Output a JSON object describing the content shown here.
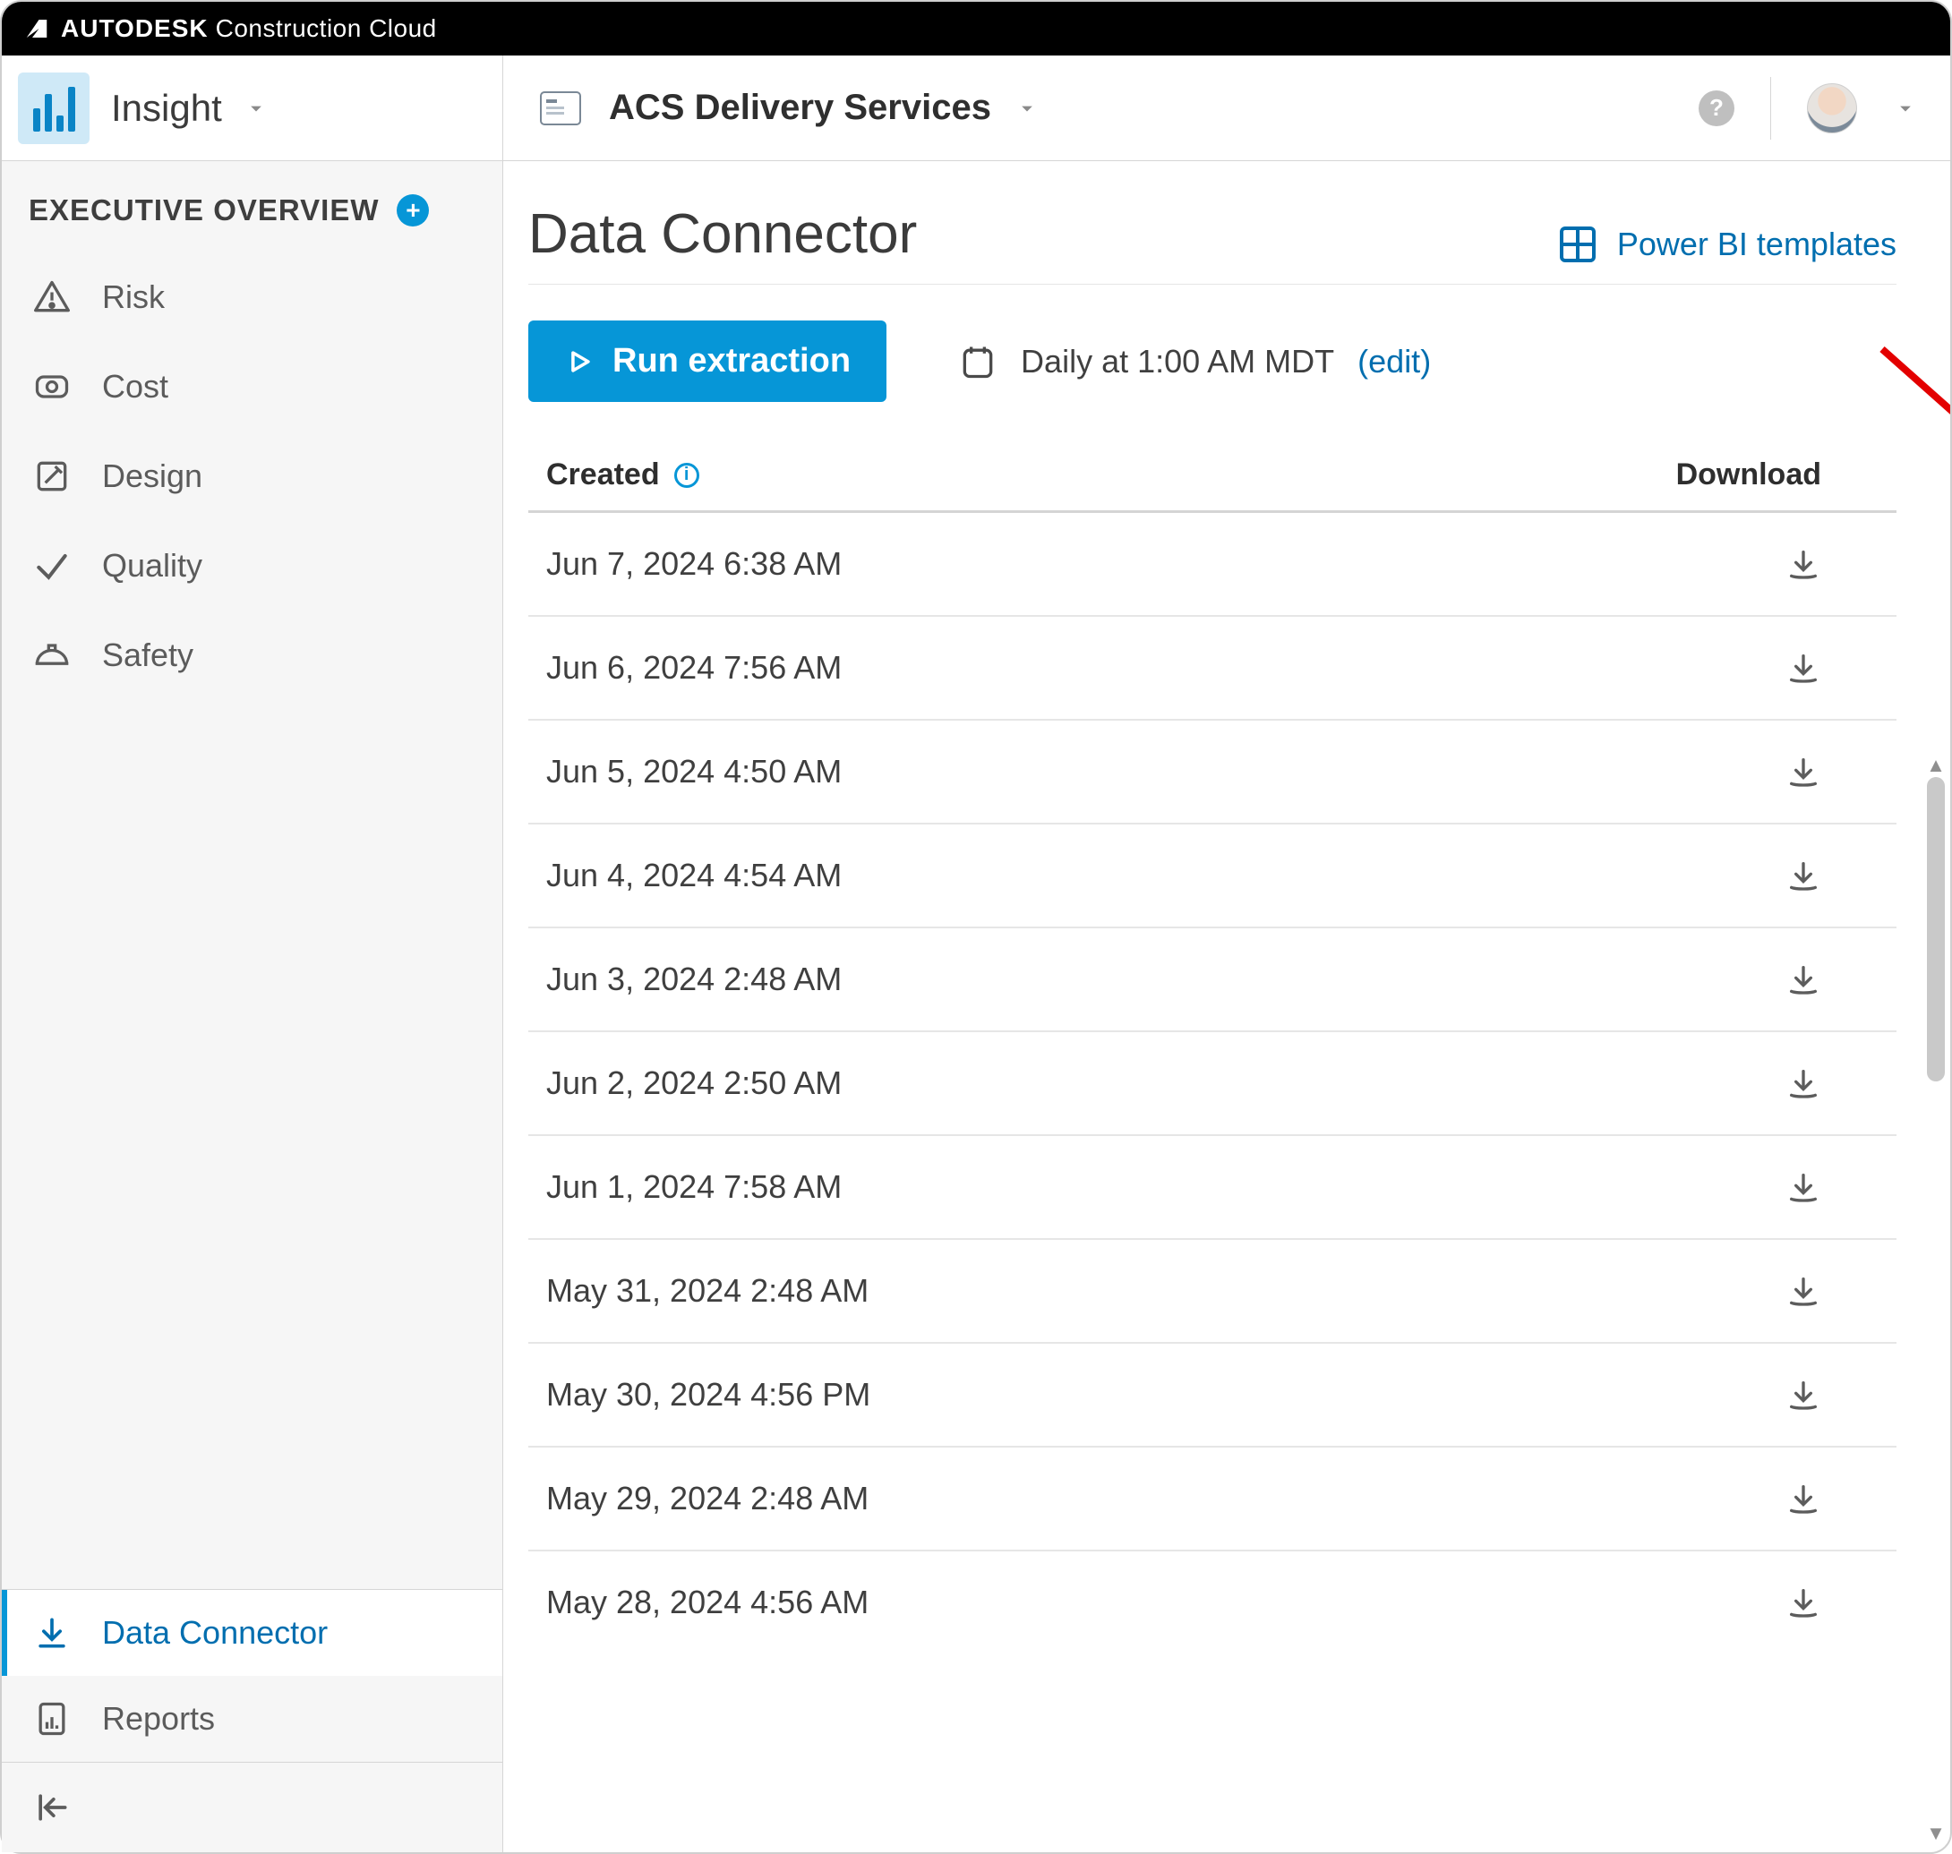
{
  "brand": {
    "strong": "AUTODESK",
    "light": "Construction Cloud"
  },
  "module": "Insight",
  "project": "ACS Delivery Services",
  "sidebar": {
    "overview_label": "EXECUTIVE OVERVIEW",
    "items": [
      {
        "label": "Risk"
      },
      {
        "label": "Cost"
      },
      {
        "label": "Design"
      },
      {
        "label": "Quality"
      },
      {
        "label": "Safety"
      }
    ],
    "tools": [
      {
        "label": "Data Connector",
        "active": true
      },
      {
        "label": "Reports",
        "active": false
      }
    ]
  },
  "page": {
    "title": "Data Connector",
    "powerbi_link": "Power BI templates",
    "run_button": "Run extraction",
    "schedule_text": "Daily at 1:00 AM MDT",
    "schedule_edit": "(edit)"
  },
  "table": {
    "created_header": "Created",
    "download_header": "Download",
    "rows": [
      {
        "created": "Jun 7, 2024 6:38 AM"
      },
      {
        "created": "Jun 6, 2024 7:56 AM"
      },
      {
        "created": "Jun 5, 2024 4:50 AM"
      },
      {
        "created": "Jun 4, 2024 4:54 AM"
      },
      {
        "created": "Jun 3, 2024 2:48 AM"
      },
      {
        "created": "Jun 2, 2024 2:50 AM"
      },
      {
        "created": "Jun 1, 2024 7:58 AM"
      },
      {
        "created": "May 31, 2024 2:48 AM"
      },
      {
        "created": "May 30, 2024 4:56 PM"
      },
      {
        "created": "May 29, 2024 2:48 AM"
      },
      {
        "created": "May 28, 2024 4:56 AM"
      }
    ]
  },
  "colors": {
    "primary": "#0696d7",
    "link": "#006eaf"
  }
}
